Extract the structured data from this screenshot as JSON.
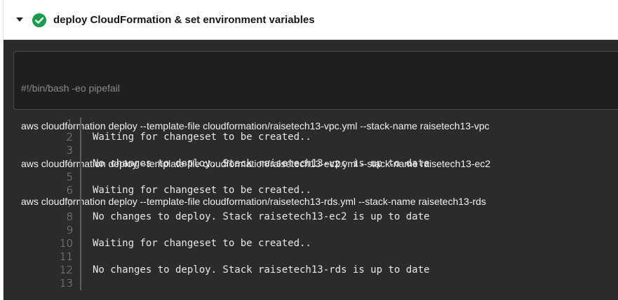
{
  "step": {
    "title": "deploy CloudFormation & set environment variables",
    "status": "success",
    "status_color": "#1a9c4a",
    "collapse_icon": "caret-down-icon",
    "status_icon": "check-circle-icon"
  },
  "command": {
    "shebang": "#!/bin/bash -eo pipefail",
    "lines": [
      "aws cloudformation deploy --template-file cloudformation/raisetech13-vpc.yml --stack-name raisetech13-vpc",
      "aws cloudformation deploy --template-file cloudformation/raisetech13-ec2.yml --stack-name raisetech13-ec2",
      "aws cloudformation deploy --template-file cloudformation/raisetech13-rds.yml --stack-name raisetech13-rds"
    ]
  },
  "output": {
    "lines": [
      {
        "number": "1",
        "text": ""
      },
      {
        "number": "2",
        "text": "Waiting for changeset to be created.."
      },
      {
        "number": "3",
        "text": ""
      },
      {
        "number": "4",
        "text": "No changes to deploy. Stack raisetech13-vpc is up to date"
      },
      {
        "number": "5",
        "text": ""
      },
      {
        "number": "6",
        "text": "Waiting for changeset to be created.."
      },
      {
        "number": "7",
        "text": ""
      },
      {
        "number": "8",
        "text": "No changes to deploy. Stack raisetech13-ec2 is up to date"
      },
      {
        "number": "9",
        "text": ""
      },
      {
        "number": "10",
        "text": "Waiting for changeset to be created.."
      },
      {
        "number": "11",
        "text": ""
      },
      {
        "number": "12",
        "text": "No changes to deploy. Stack raisetech13-rds is up to date"
      },
      {
        "number": "13",
        "text": ""
      }
    ]
  }
}
